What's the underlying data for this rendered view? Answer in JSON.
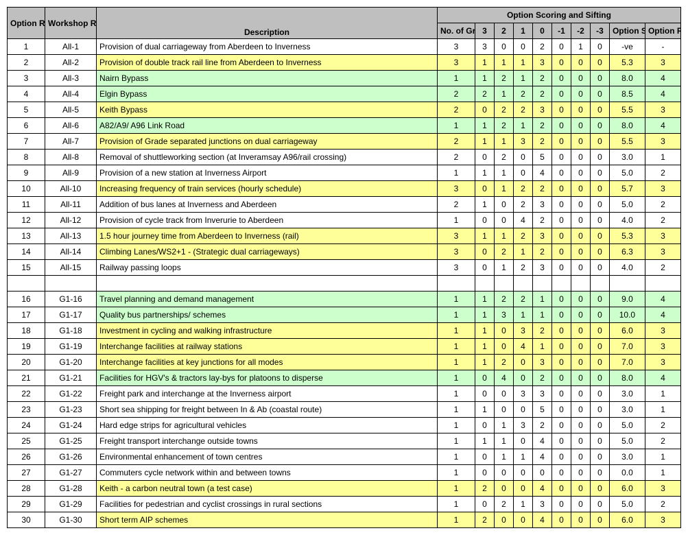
{
  "header": {
    "scoring_title": "Option Scoring and Sifting",
    "option_ref": "Option Ref.",
    "workshop_ref": "Workshop Ref.",
    "description": "Description",
    "no_of_groups": "No. of Groups",
    "s3": "3",
    "s2": "2",
    "s1": "1",
    "s0": "0",
    "sm1": "-1",
    "sm2": "-2",
    "sm3": "-3",
    "option_score": "Option Score",
    "option_rating": "Option Rating"
  },
  "sep_after": 15,
  "rows": [
    {
      "ref": "1",
      "wref": "All-1",
      "desc": "Provision of dual carriageway from Aberdeen to Inverness",
      "ng": "3",
      "v": [
        "3",
        "0",
        "0",
        "2",
        "0",
        "1",
        "0"
      ],
      "score": "-ve",
      "rating": "-",
      "hl": "w"
    },
    {
      "ref": "2",
      "wref": "All-2",
      "desc": "Provision of double track rail line from Aberdeen to Inverness",
      "ng": "3",
      "v": [
        "1",
        "1",
        "1",
        "3",
        "0",
        "0",
        "0"
      ],
      "score": "5.3",
      "rating": "3",
      "hl": "y"
    },
    {
      "ref": "3",
      "wref": "All-3",
      "desc": "Nairn Bypass",
      "ng": "1",
      "v": [
        "1",
        "2",
        "1",
        "2",
        "0",
        "0",
        "0"
      ],
      "score": "8.0",
      "rating": "4",
      "hl": "g"
    },
    {
      "ref": "4",
      "wref": "All-4",
      "desc": "Elgin Bypass",
      "ng": "2",
      "v": [
        "2",
        "1",
        "2",
        "2",
        "0",
        "0",
        "0"
      ],
      "score": "8.5",
      "rating": "4",
      "hl": "g"
    },
    {
      "ref": "5",
      "wref": "All-5",
      "desc": "Keith Bypass",
      "ng": "2",
      "v": [
        "0",
        "2",
        "2",
        "3",
        "0",
        "0",
        "0"
      ],
      "score": "5.5",
      "rating": "3",
      "hl": "y"
    },
    {
      "ref": "6",
      "wref": "All-6",
      "desc": "A82/A9/ A96 Link Road",
      "ng": "1",
      "v": [
        "1",
        "2",
        "1",
        "2",
        "0",
        "0",
        "0"
      ],
      "score": "8.0",
      "rating": "4",
      "hl": "g"
    },
    {
      "ref": "7",
      "wref": "All-7",
      "desc": "Provision of Grade separated junctions on dual carriageway",
      "ng": "2",
      "v": [
        "1",
        "1",
        "3",
        "2",
        "0",
        "0",
        "0"
      ],
      "score": "5.5",
      "rating": "3",
      "hl": "y"
    },
    {
      "ref": "8",
      "wref": "All-8",
      "desc": "Removal of shuttleworking section (at Inveramsay A96/rail crossing)",
      "ng": "2",
      "v": [
        "0",
        "2",
        "0",
        "5",
        "0",
        "0",
        "0"
      ],
      "score": "3.0",
      "rating": "1",
      "hl": "w"
    },
    {
      "ref": "9",
      "wref": "All-9",
      "desc": "Provision of a new station at Inverness Airport",
      "ng": "1",
      "v": [
        "1",
        "1",
        "0",
        "4",
        "0",
        "0",
        "0"
      ],
      "score": "5.0",
      "rating": "2",
      "hl": "w"
    },
    {
      "ref": "10",
      "wref": "All-10",
      "desc": "Increasing frequency of train services (hourly schedule)",
      "ng": "3",
      "v": [
        "0",
        "1",
        "2",
        "2",
        "0",
        "0",
        "0"
      ],
      "score": "5.7",
      "rating": "3",
      "hl": "y"
    },
    {
      "ref": "11",
      "wref": "All-11",
      "desc": "Addition of bus lanes at Inverness and Aberdeen",
      "ng": "2",
      "v": [
        "1",
        "0",
        "2",
        "3",
        "0",
        "0",
        "0"
      ],
      "score": "5.0",
      "rating": "2",
      "hl": "w"
    },
    {
      "ref": "12",
      "wref": "All-12",
      "desc": "Provision of cycle track from Inverurie to Aberdeen",
      "ng": "1",
      "v": [
        "0",
        "0",
        "4",
        "2",
        "0",
        "0",
        "0"
      ],
      "score": "4.0",
      "rating": "2",
      "hl": "w"
    },
    {
      "ref": "13",
      "wref": "All-13",
      "desc": "1.5 hour journey time from Aberdeen to Inverness (rail)",
      "ng": "3",
      "v": [
        "1",
        "1",
        "2",
        "3",
        "0",
        "0",
        "0"
      ],
      "score": "5.3",
      "rating": "3",
      "hl": "y"
    },
    {
      "ref": "14",
      "wref": "All-14",
      "desc": "Climbing Lanes/WS2+1 - (Strategic dual carriageways)",
      "ng": "3",
      "v": [
        "0",
        "2",
        "1",
        "2",
        "0",
        "0",
        "0"
      ],
      "score": "6.3",
      "rating": "3",
      "hl": "y"
    },
    {
      "ref": "15",
      "wref": "All-15",
      "desc": "Railway passing loops",
      "ng": "3",
      "v": [
        "0",
        "1",
        "2",
        "3",
        "0",
        "0",
        "0"
      ],
      "score": "4.0",
      "rating": "2",
      "hl": "w"
    },
    {
      "ref": "16",
      "wref": "G1-16",
      "desc": "Travel planning and demand management",
      "ng": "1",
      "v": [
        "1",
        "2",
        "2",
        "1",
        "0",
        "0",
        "0"
      ],
      "score": "9.0",
      "rating": "4",
      "hl": "g"
    },
    {
      "ref": "17",
      "wref": "G1-17",
      "desc": "Quality bus partnerships/ schemes",
      "ng": "1",
      "v": [
        "1",
        "3",
        "1",
        "1",
        "0",
        "0",
        "0"
      ],
      "score": "10.0",
      "rating": "4",
      "hl": "g"
    },
    {
      "ref": "18",
      "wref": "G1-18",
      "desc": "Investment in cycling and walking infrastructure",
      "ng": "1",
      "v": [
        "1",
        "0",
        "3",
        "2",
        "0",
        "0",
        "0"
      ],
      "score": "6.0",
      "rating": "3",
      "hl": "y"
    },
    {
      "ref": "19",
      "wref": "G1-19",
      "desc": "Interchange facilities at railway stations",
      "ng": "1",
      "v": [
        "1",
        "0",
        "4",
        "1",
        "0",
        "0",
        "0"
      ],
      "score": "7.0",
      "rating": "3",
      "hl": "y"
    },
    {
      "ref": "20",
      "wref": "G1-20",
      "desc": "Interchange facilities at key junctions for all modes",
      "ng": "1",
      "v": [
        "1",
        "2",
        "0",
        "3",
        "0",
        "0",
        "0"
      ],
      "score": "7.0",
      "rating": "3",
      "hl": "y"
    },
    {
      "ref": "21",
      "wref": "G1-21",
      "desc": "Facilities for HGV's & tractors lay-bys for platoons to disperse",
      "ng": "1",
      "v": [
        "0",
        "4",
        "0",
        "2",
        "0",
        "0",
        "0"
      ],
      "score": "8.0",
      "rating": "4",
      "hl": "g"
    },
    {
      "ref": "22",
      "wref": "G1-22",
      "desc": "Freight park and interchange at the Inverness airport",
      "ng": "1",
      "v": [
        "0",
        "0",
        "3",
        "3",
        "0",
        "0",
        "0"
      ],
      "score": "3.0",
      "rating": "1",
      "hl": "w"
    },
    {
      "ref": "23",
      "wref": "G1-23",
      "desc": "Short sea shipping for freight between In & Ab (coastal route)",
      "ng": "1",
      "v": [
        "1",
        "0",
        "0",
        "5",
        "0",
        "0",
        "0"
      ],
      "score": "3.0",
      "rating": "1",
      "hl": "w"
    },
    {
      "ref": "24",
      "wref": "G1-24",
      "desc": "Hard edge strips for agricultural vehicles",
      "ng": "1",
      "v": [
        "0",
        "1",
        "3",
        "2",
        "0",
        "0",
        "0"
      ],
      "score": "5.0",
      "rating": "2",
      "hl": "w"
    },
    {
      "ref": "25",
      "wref": "G1-25",
      "desc": "Freight transport interchange outside towns",
      "ng": "1",
      "v": [
        "1",
        "1",
        "0",
        "4",
        "0",
        "0",
        "0"
      ],
      "score": "5.0",
      "rating": "2",
      "hl": "w"
    },
    {
      "ref": "26",
      "wref": "G1-26",
      "desc": "Environmental enhancement of town centres",
      "ng": "1",
      "v": [
        "0",
        "1",
        "1",
        "4",
        "0",
        "0",
        "0"
      ],
      "score": "3.0",
      "rating": "1",
      "hl": "w"
    },
    {
      "ref": "27",
      "wref": "G1-27",
      "desc": "Commuters cycle network within and between towns",
      "ng": "1",
      "v": [
        "0",
        "0",
        "0",
        "0",
        "0",
        "0",
        "0"
      ],
      "score": "0.0",
      "rating": "1",
      "hl": "w"
    },
    {
      "ref": "28",
      "wref": "G1-28",
      "desc": "Keith - a carbon neutral town (a test case)",
      "ng": "1",
      "v": [
        "2",
        "0",
        "0",
        "4",
        "0",
        "0",
        "0"
      ],
      "score": "6.0",
      "rating": "3",
      "hl": "y"
    },
    {
      "ref": "29",
      "wref": "G1-29",
      "desc": "Facilities for pedestrian and cyclist crossings in rural sections",
      "ng": "1",
      "v": [
        "0",
        "2",
        "1",
        "3",
        "0",
        "0",
        "0"
      ],
      "score": "5.0",
      "rating": "2",
      "hl": "w"
    },
    {
      "ref": "30",
      "wref": "G1-30",
      "desc": "Short term AIP schemes",
      "ng": "1",
      "v": [
        "2",
        "0",
        "0",
        "4",
        "0",
        "0",
        "0"
      ],
      "score": "6.0",
      "rating": "3",
      "hl": "y"
    }
  ]
}
